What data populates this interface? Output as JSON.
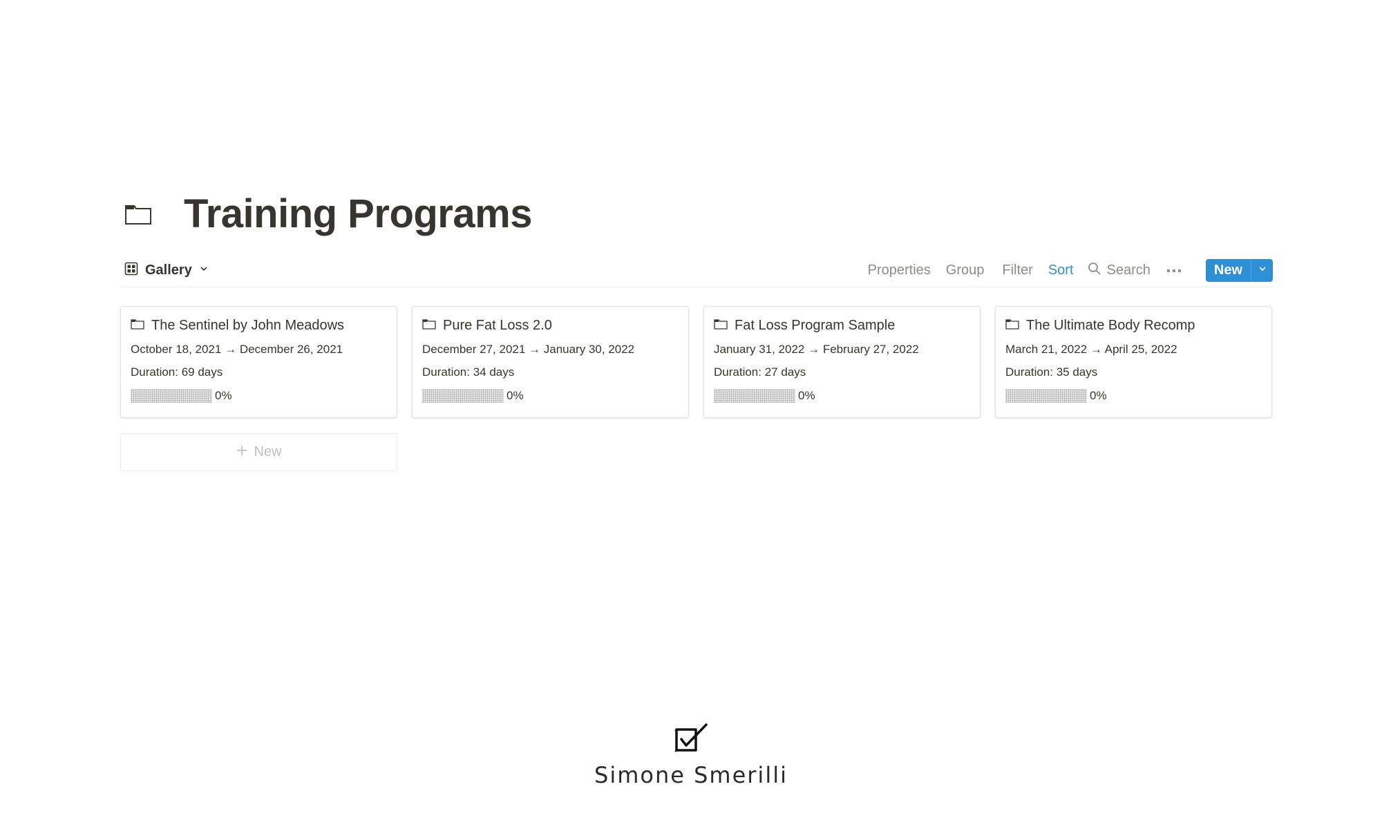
{
  "page": {
    "title": "Training Programs",
    "title_icon": "folder-icon"
  },
  "toolbar": {
    "view_label": "Gallery",
    "view_icon": "gallery-grid-icon",
    "properties": "Properties",
    "group": "Group",
    "filter": "Filter",
    "sort": "Sort",
    "search": "Search",
    "new_label": "New",
    "active_color": "#2e90d0",
    "new_button_color": "#2d8fd6"
  },
  "cards": [
    {
      "title": "The Sentinel by John Meadows",
      "dates": "October 18, 2021 → December 26, 2021",
      "duration": "Duration: 69 days",
      "progress_text": "0%",
      "progress": 0
    },
    {
      "title": "Pure Fat Loss 2.0",
      "dates": "December 27, 2021 → January 30, 2022",
      "duration": "Duration: 34 days",
      "progress_text": "0%",
      "progress": 0
    },
    {
      "title": "Fat Loss Program Sample",
      "dates": "January 31, 2022 → February 27, 2022",
      "duration": "Duration: 27 days",
      "progress_text": "0%",
      "progress": 0
    },
    {
      "title": "The Ultimate Body Recomp",
      "dates": "March 21, 2022 → April 25, 2022",
      "duration": "Duration: 35 days",
      "progress_text": "0%",
      "progress": 0
    }
  ],
  "add_new": {
    "label": "New"
  },
  "brand": {
    "name": "Simone Smerilli",
    "logo_icon": "checkbox-logo-icon"
  }
}
